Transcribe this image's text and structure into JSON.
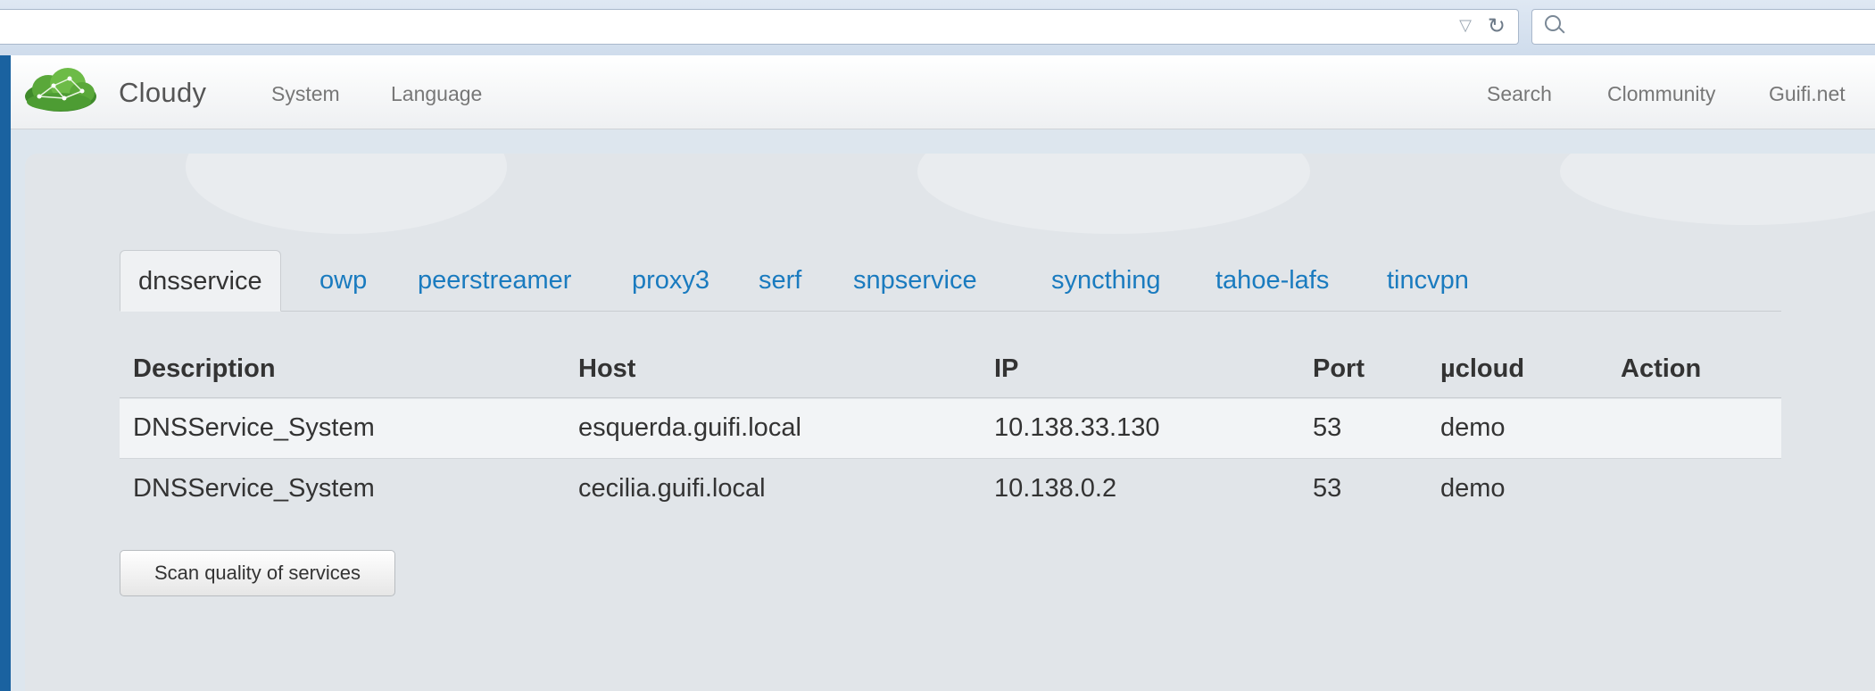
{
  "browser": {
    "url_value": "",
    "search_value": ""
  },
  "navbar": {
    "brand": "Cloudy",
    "left_items": [
      {
        "label": "System"
      },
      {
        "label": "Language"
      }
    ],
    "right_items": [
      {
        "label": "Search"
      },
      {
        "label": "Clommunity"
      },
      {
        "label": "Guifi.net"
      }
    ]
  },
  "tabs": [
    {
      "label": "dnsservice",
      "active": true
    },
    {
      "label": "owp"
    },
    {
      "label": "peerstreamer"
    },
    {
      "label": "proxy3"
    },
    {
      "label": "serf"
    },
    {
      "label": "snpservice"
    },
    {
      "label": "syncthing"
    },
    {
      "label": "tahoe-lafs"
    },
    {
      "label": "tincvpn"
    }
  ],
  "table": {
    "columns": [
      "Description",
      "Host",
      "IP",
      "Port",
      "µcloud",
      "Action"
    ],
    "rows": [
      [
        "DNSService_System",
        "esquerda.guifi.local",
        "10.138.33.130",
        "53",
        "demo",
        ""
      ],
      [
        "DNSService_System",
        "cecilia.guifi.local",
        "10.138.0.2",
        "53",
        "demo",
        ""
      ]
    ]
  },
  "actions": {
    "scan_label": "Scan quality of services"
  },
  "colors": {
    "link": "#1a7bbf",
    "brand_green": "#5aa83a",
    "window_frame": "#1e6aa8"
  },
  "icons": {
    "logo": "cloud-network-logo",
    "url_dropdown": "triangle-down-icon",
    "reload": "reload-icon",
    "search": "search-icon"
  }
}
